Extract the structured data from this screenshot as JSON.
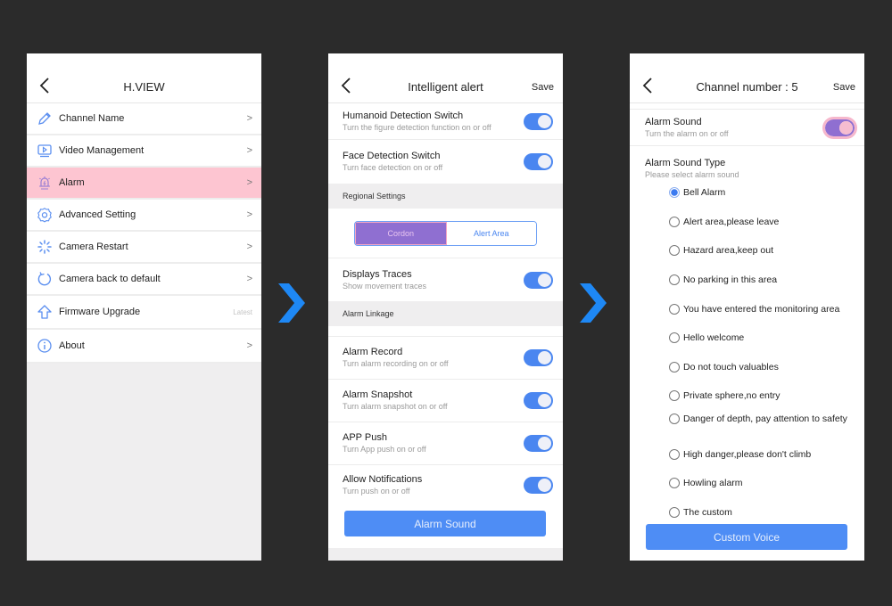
{
  "colors": {
    "background": "#2b2b2b",
    "accent_blue": "#4a86f0",
    "arrow_blue": "#1e88f5",
    "highlight_pink": "#fdc5d1",
    "segment_purple": "#8f6fd1"
  },
  "panel1": {
    "title": "H.VIEW",
    "back_icon": "chevron-left-icon",
    "items": [
      {
        "label": "Channel Name",
        "icon": "pencil-icon",
        "trailing": ">"
      },
      {
        "label": "Video Management",
        "icon": "video-icon",
        "trailing": ">"
      },
      {
        "label": "Alarm",
        "icon": "alarm-icon",
        "trailing": ">",
        "highlighted": true
      },
      {
        "label": "Advanced Setting",
        "icon": "gear-icon",
        "trailing": ">"
      },
      {
        "label": "Camera Restart",
        "icon": "spinner-icon",
        "trailing": ">"
      },
      {
        "label": "Camera back to default",
        "icon": "refresh-icon",
        "trailing": ">"
      },
      {
        "label": "Firmware Upgrade",
        "icon": "upgrade-icon",
        "trailing": "Latest"
      },
      {
        "label": "About",
        "icon": "info-icon",
        "trailing": ">"
      }
    ]
  },
  "panel2": {
    "title": "Intelligent alert",
    "save_label": "Save",
    "switches_top": [
      {
        "title": "Humanoid Detection Switch",
        "subtitle": "Turn the figure detection function on or off",
        "on": true
      },
      {
        "title": "Face Detection Switch",
        "subtitle": "Turn face detection on or off",
        "on": true
      }
    ],
    "regional_header": "Regional Settings",
    "segment": {
      "options": [
        "Cordon",
        "Alert Area"
      ],
      "selected": "Cordon"
    },
    "traces": {
      "title": "Displays Traces",
      "subtitle": "Show movement traces",
      "on": true
    },
    "linkage_header": "Alarm Linkage",
    "linkage_switches": [
      {
        "title": "Alarm Record",
        "subtitle": "Turn alarm recording on or off",
        "on": true
      },
      {
        "title": "Alarm Snapshot",
        "subtitle": "Turn alarm snapshot on or off",
        "on": true
      },
      {
        "title": "APP Push",
        "subtitle": "Turn App push on or off",
        "on": true
      },
      {
        "title": "Allow Notifications",
        "subtitle": "Turn push on or off",
        "on": true
      }
    ],
    "button_label": "Alarm Sound"
  },
  "panel3": {
    "title": "Channel number : 5",
    "save_label": "Save",
    "alarm_sound": {
      "title": "Alarm Sound",
      "subtitle": "Turn the alarm on or off",
      "on": true
    },
    "type_title": "Alarm Sound Type",
    "type_subtitle": "Please select alarm sound",
    "options": [
      "Bell Alarm",
      "Alert area,please leave",
      "Hazard area,keep out",
      "No parking in this area",
      "You have entered the monitoring area",
      "Hello welcome",
      "Do not touch valuables",
      "Private sphere,no entry",
      "Danger of depth, pay attention to safety",
      "High danger,please don't climb",
      "Howling alarm",
      "The custom"
    ],
    "selected_option": "Bell Alarm",
    "button_label": "Custom Voice"
  }
}
